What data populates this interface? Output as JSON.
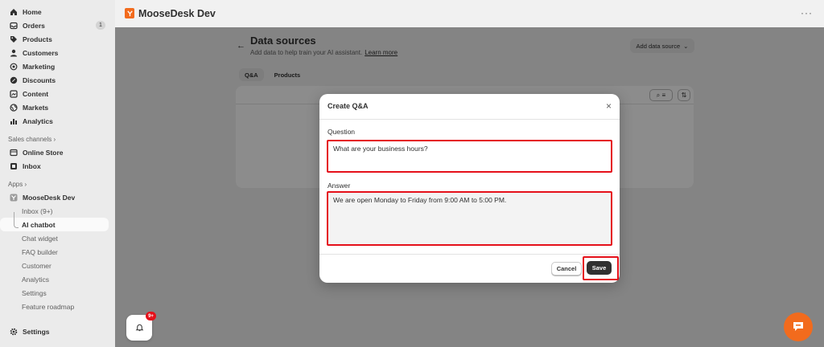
{
  "brand": {
    "title": "MooseDesk Dev",
    "color": "#f26b1d"
  },
  "sidebar": {
    "items": [
      {
        "label": "Home",
        "icon": "home-icon"
      },
      {
        "label": "Orders",
        "icon": "inbox-icon",
        "count": "1"
      },
      {
        "label": "Products",
        "icon": "tag-icon"
      },
      {
        "label": "Customers",
        "icon": "person-icon"
      },
      {
        "label": "Marketing",
        "icon": "target-icon"
      },
      {
        "label": "Discounts",
        "icon": "discount-icon"
      },
      {
        "label": "Content",
        "icon": "content-icon"
      },
      {
        "label": "Markets",
        "icon": "globe-icon"
      },
      {
        "label": "Analytics",
        "icon": "bar-chart-icon"
      }
    ],
    "sales_channels_label": "Sales channels",
    "sales_channels": [
      {
        "label": "Online Store",
        "icon": "store-icon"
      },
      {
        "label": "Inbox",
        "icon": "chat-icon"
      }
    ],
    "apps_label": "Apps",
    "app_name": "MooseDesk Dev",
    "app_subitems": [
      "Inbox (9+)",
      "AI chatbot",
      "Chat widget",
      "FAQ builder",
      "Customer",
      "Analytics",
      "Settings",
      "Feature roadmap"
    ],
    "settings_label": "Settings"
  },
  "page": {
    "title": "Data sources",
    "subtitle": "Add data to help train your AI assistant.",
    "learn_more": "Learn more",
    "add_source": "Add data source",
    "tabs": [
      "Q&A",
      "Products"
    ]
  },
  "modal": {
    "title": "Create Q&A",
    "question_label": "Question",
    "question_value": "What are your business hours?",
    "answer_label": "Answer",
    "answer_value": "We are open Monday to Friday from 9:00 AM to 5:00 PM.",
    "cancel": "Cancel",
    "save": "Save"
  },
  "notifications": {
    "badge": "9+"
  }
}
